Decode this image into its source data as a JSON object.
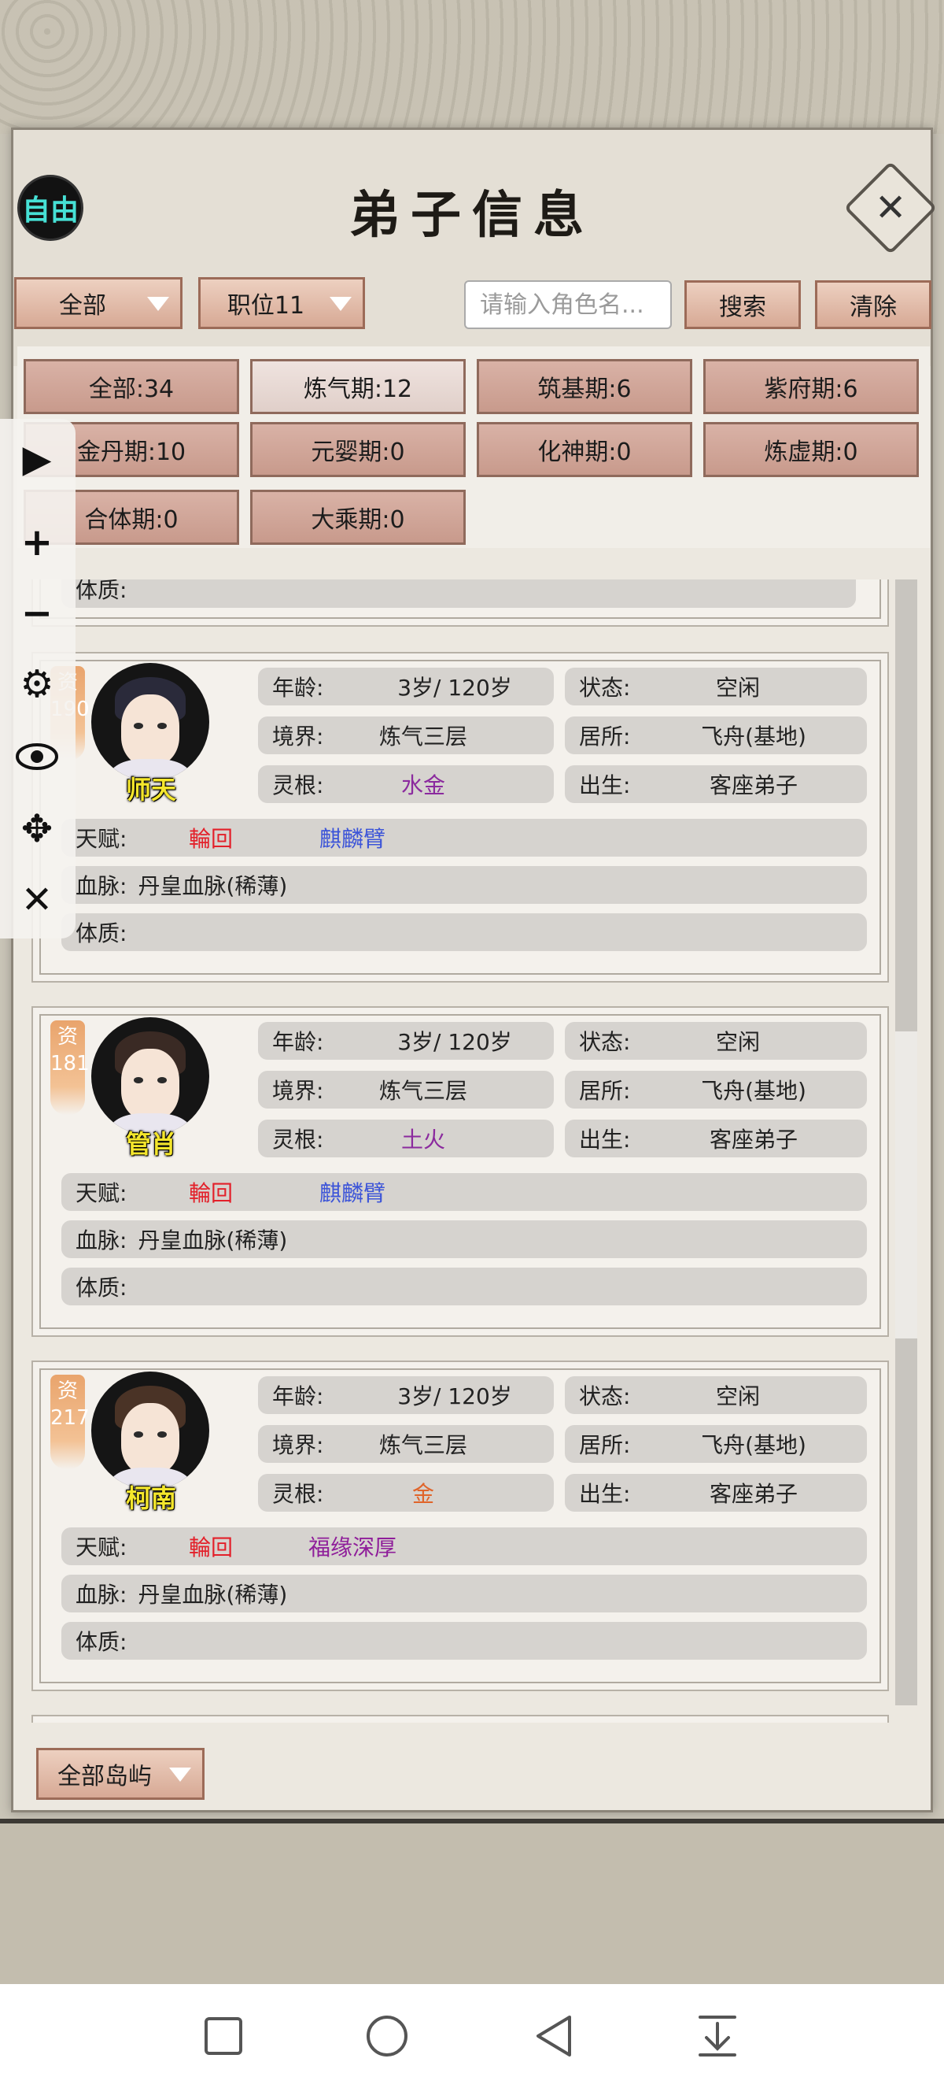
{
  "header": {
    "mode_badge": "自由",
    "title": "弟子信息",
    "close_icon": "close-icon"
  },
  "toolbar": {
    "filter_all": "全部",
    "filter_position": "职位11",
    "search_placeholder": "请输入角色名...",
    "search_label": "搜索",
    "clear_label": "清除"
  },
  "realm_filters": [
    {
      "label": "全部:34"
    },
    {
      "label": "炼气期:12"
    },
    {
      "label": "筑基期:6"
    },
    {
      "label": "紫府期:6"
    },
    {
      "label": "金丹期:10"
    },
    {
      "label": "元婴期:0"
    },
    {
      "label": "化神期:0"
    },
    {
      "label": "炼虚期:0"
    },
    {
      "label": "合体期:0"
    },
    {
      "label": "大乘期:0"
    }
  ],
  "labels": {
    "age": "年龄:",
    "status": "状态:",
    "realm": "境界:",
    "residence": "居所:",
    "root": "灵根:",
    "origin": "出生:",
    "talent": "天赋:",
    "bloodline": "血脉:",
    "physique": "体质:",
    "rank_char": "资"
  },
  "partial_card_physique": "体质:",
  "disciples": [
    {
      "name": "师天",
      "rank": "190",
      "age": "3岁/ 120岁",
      "status": "空闲",
      "realm": "炼气三层",
      "residence": "飞舟(基地)",
      "root": "水金",
      "origin": "客座弟子",
      "talent_1": "輪回",
      "talent_2": "麒麟臂",
      "bloodline": "丹皇血脉(稀薄)",
      "physique": ""
    },
    {
      "name": "管肖",
      "rank": "181",
      "age": "3岁/ 120岁",
      "status": "空闲",
      "realm": "炼气三层",
      "residence": "飞舟(基地)",
      "root": "土火",
      "origin": "客座弟子",
      "talent_1": "輪回",
      "talent_2": "麒麟臂",
      "bloodline": "丹皇血脉(稀薄)",
      "physique": ""
    },
    {
      "name": "柯南",
      "rank": "217",
      "age": "3岁/ 120岁",
      "status": "空闲",
      "realm": "炼气三层",
      "residence": "飞舟(基地)",
      "root": "金",
      "origin": "客座弟子",
      "talent_1": "輪回",
      "talent_2": "福缘深厚",
      "bloodline": "丹皇血脉(稀薄)",
      "physique": ""
    }
  ],
  "footer": {
    "island_filter": "全部岛屿"
  },
  "colors": {
    "accent_button": "#d7a995",
    "panel_bg": "#ece8e0",
    "talent_red": "#e3202a",
    "talent_blue": "#3d55d8",
    "root_purple": "#8b2a9e",
    "root_orange": "#e0642a",
    "name_yellow": "#f4e62c"
  }
}
